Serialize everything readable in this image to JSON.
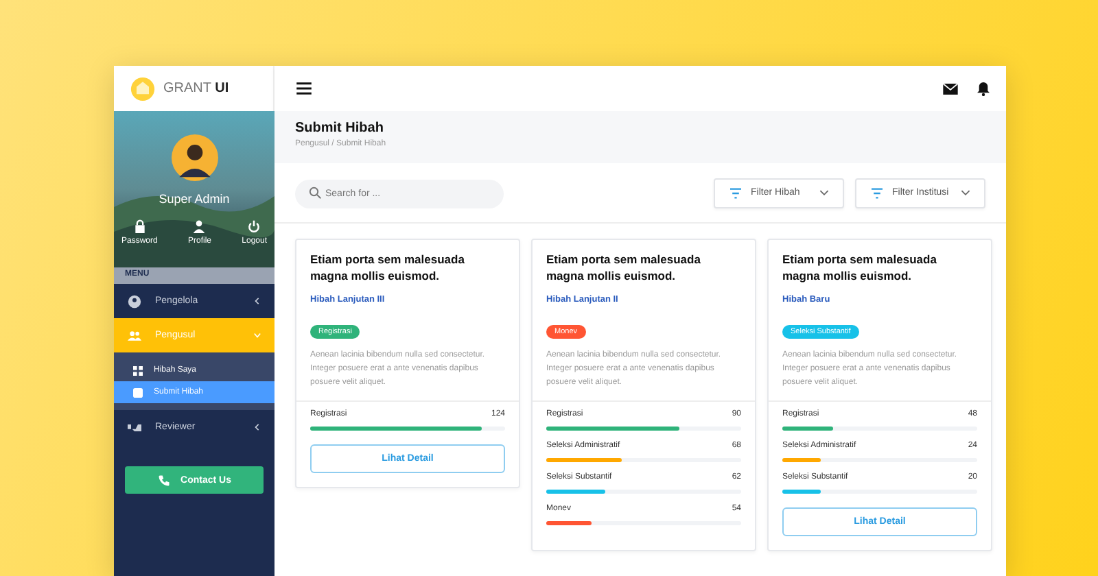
{
  "brand": {
    "name": "GRANT",
    "name_bold": "UI"
  },
  "user": {
    "name": "Super Admin"
  },
  "profile_actions": [
    {
      "kind": "lock",
      "label": "Password"
    },
    {
      "kind": "person",
      "label": "Profile"
    },
    {
      "kind": "power",
      "label": "Logout"
    }
  ],
  "menu_label": "MENU",
  "menu": [
    {
      "kind": "user",
      "label": "Pengelola",
      "selected": false,
      "expanded": false
    },
    {
      "kind": "group",
      "label": "Pengusul",
      "selected": true,
      "expanded": true,
      "children": [
        {
          "kind": "grid",
          "label": "Hibah Saya",
          "selected": false
        },
        {
          "kind": "edit",
          "label": "Submit Hibah",
          "selected": true
        }
      ]
    },
    {
      "kind": "thumbs",
      "label": "Reviewer",
      "selected": false,
      "expanded": false
    }
  ],
  "contact_button": "Contact Us",
  "page": {
    "title": "Submit Hibah",
    "breadcrumb": "Pengusul / Submit Hibah"
  },
  "search": {
    "placeholder": "Search for ..."
  },
  "filters": [
    "Filter Hibah",
    "Filter Institusi"
  ],
  "cards": [
    {
      "title": "Etiam porta sem malesuada magna mollis euismod.",
      "category": "Hibah Lanjutan III",
      "badge": "Registrasi",
      "color": "#2fb37a",
      "description": "Aenean lacinia bibendum nulla sed consectetur. Integer posuere erat a ante venenatis dapibus posuere velit aliquet.",
      "stats": [
        {
          "label": "Registrasi",
          "value": "124",
          "level": 0.88,
          "color": "#2fb37a"
        }
      ],
      "button": "Lihat Detail"
    },
    {
      "title": "Etiam porta sem malesuada magna mollis euismod.",
      "category": "Hibah Lanjutan II",
      "badge": "Monev",
      "color": "#ff5533",
      "description": "Aenean lacinia bibendum nulla sed consectetur. Integer posuere erat a ante venenatis dapibus posuere velit aliquet.",
      "stats": [
        {
          "label": "Registrasi",
          "value": "90",
          "level": 0.68,
          "color": "#2fb37a"
        },
        {
          "label": "Seleksi Administratif",
          "value": "68",
          "level": 0.39,
          "color": "#ffa800"
        },
        {
          "label": "Seleksi Substantif",
          "value": "62",
          "level": 0.3,
          "color": "#17c1e8"
        },
        {
          "label": "Monev",
          "value": "54",
          "level": 0.23,
          "color": "#ff5533"
        }
      ]
    },
    {
      "title": "Etiam porta sem malesuada magna mollis euismod.",
      "category": "Hibah Baru",
      "badge": "Seleksi Substantif",
      "color": "#17c1e8",
      "description": "Aenean lacinia bibendum nulla sed consectetur. Integer posuere erat a ante venenatis dapibus posuere velit aliquet.",
      "stats": [
        {
          "label": "Registrasi",
          "value": "48",
          "level": 0.26,
          "color": "#2fb37a"
        },
        {
          "label": "Seleksi Administratif",
          "value": "24",
          "level": 0.2,
          "color": "#ffa800"
        },
        {
          "label": "Seleksi Substantif",
          "value": "20",
          "level": 0.2,
          "color": "#17c1e8"
        }
      ],
      "button": "Lihat Detail"
    }
  ]
}
